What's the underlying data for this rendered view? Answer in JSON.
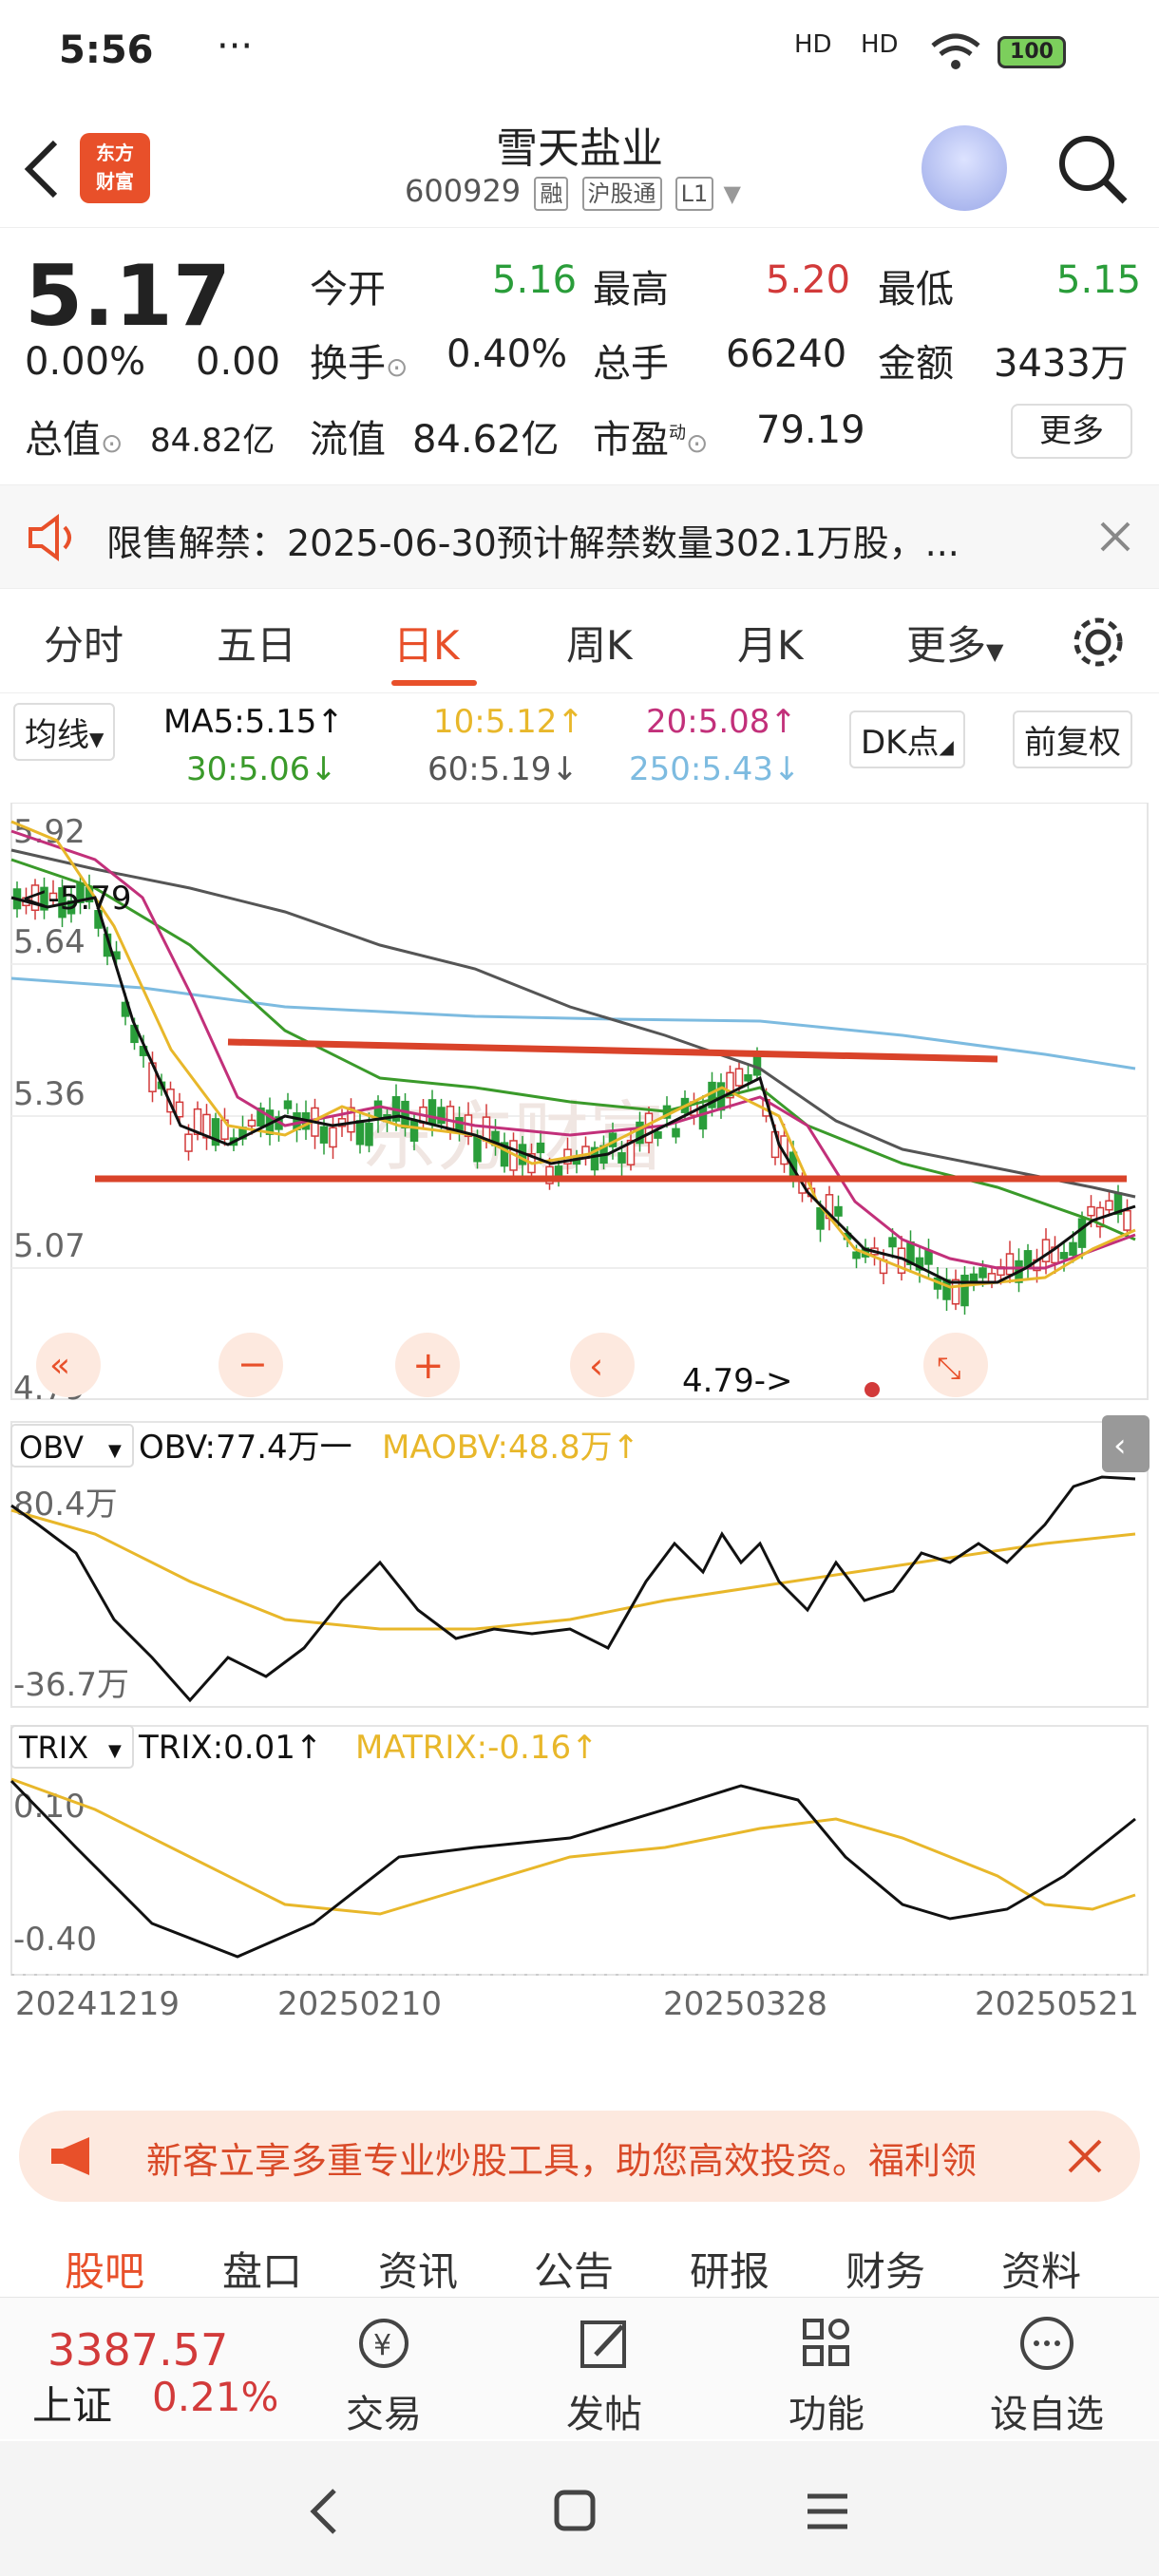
{
  "status_bar": {
    "time": "5:56",
    "dots": "···",
    "signal1": "HD",
    "signal2": "HD",
    "battery": "100"
  },
  "header": {
    "logo_line1": "东方",
    "logo_line2": "财富",
    "stock_name": "雪天盐业",
    "stock_code": "600929",
    "tags": [
      "融",
      "沪股通",
      "L1"
    ]
  },
  "quote": {
    "price": "5.17",
    "change_pct": "0.00%",
    "change": "0.00",
    "open_label": "今开",
    "open": "5.16",
    "high_label": "最高",
    "high": "5.20",
    "low_label": "最低",
    "low": "5.15",
    "turnover_label": "换手",
    "turnover": "0.40%",
    "volume_label": "总手",
    "volume": "66240",
    "amount_label": "金额",
    "amount": "3433万",
    "mktcap_label": "总值",
    "mktcap": "84.82亿",
    "float_label": "流值",
    "float": "84.62亿",
    "pe_label": "市盈",
    "pe_sup": "动",
    "pe": "79.19",
    "more": "更多"
  },
  "notice": {
    "text": "限售解禁：2025-06-30预计解禁数量302.1万股，..."
  },
  "tabs": [
    "分时",
    "五日",
    "日K",
    "周K",
    "月K",
    "更多"
  ],
  "ma_row": {
    "selector": "均线",
    "ma5": "MA5:5.15↑",
    "ma10": "10:5.12↑",
    "ma20": "20:5.08↑",
    "ma30": "30:5.06↓",
    "ma60": "60:5.19↓",
    "ma250": "250:5.43↓",
    "dk": "DK点",
    "adjust": "前复权"
  },
  "chart_labels": {
    "price_ticks": [
      "5.92",
      "5.64",
      "5.36",
      "5.07",
      "4.79"
    ],
    "high_marker": "<-5.79",
    "low_marker": "4.79->",
    "obv_selector": "OBV",
    "obv_value": "OBV:77.4万一",
    "maobv_value": "MAOBV:48.8万↑",
    "obv_ticks": [
      "80.4万",
      "-36.7万"
    ],
    "trix_selector": "TRIX",
    "trix_value": "TRIX:0.01↑",
    "matrix_value": "MATRIX:-0.16↑",
    "trix_ticks": [
      "0.10",
      "-0.40"
    ],
    "dates": [
      "20241219",
      "20250210",
      "20250328",
      "20250521"
    ],
    "watermark": "东方财富"
  },
  "chart_data": {
    "type": "candlestick",
    "ylim": [
      4.79,
      5.92
    ],
    "ma_current": {
      "MA5": 5.15,
      "MA10": 5.12,
      "MA20": 5.08,
      "MA30": 5.06,
      "MA60": 5.19,
      "MA250": 5.43
    },
    "series_colors": {
      "MA5": "#111111",
      "MA10": "#e8b72a",
      "MA20": "#c2307a",
      "MA30": "#3a9a2a",
      "MA60": "#555555",
      "MA250": "#7dbbe0"
    },
    "obv": {
      "OBV": "77.4万",
      "MAOBV": "48.8万"
    },
    "trix": {
      "TRIX": 0.01,
      "MATRIX": -0.16
    }
  },
  "banner": {
    "text": "新客立享多重专业炒股工具，助您高效投资。福利领"
  },
  "subtabs": [
    "股吧",
    "盘口",
    "资讯",
    "公告",
    "研报",
    "财务",
    "资料"
  ],
  "bottom": {
    "index_value": "3387.57",
    "index_name": "上证",
    "index_change": "0.21%",
    "items": [
      "交易",
      "发帖",
      "功能",
      "设自选"
    ]
  },
  "colors": {
    "accent": "#e8502a",
    "up": "#d23a3a",
    "down": "#2a9d3a"
  }
}
